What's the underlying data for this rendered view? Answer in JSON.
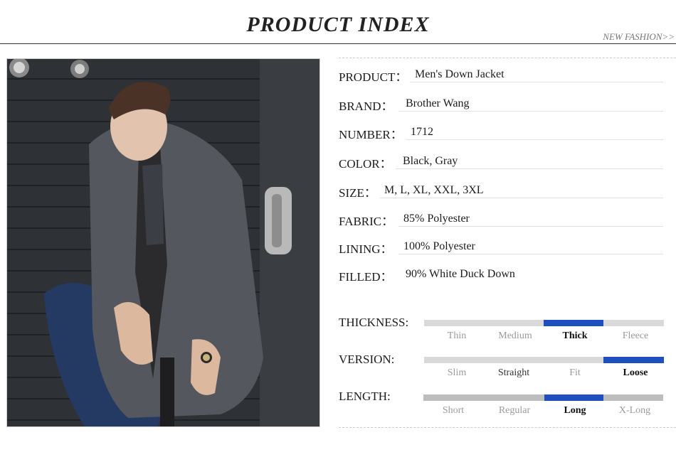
{
  "header": {
    "title": "PRODUCT INDEX",
    "tagline": "NEW FASHION>>"
  },
  "specs": [
    {
      "label": "PRODUCT：",
      "value": "Men's Down Jacket"
    },
    {
      "label": "BRAND：",
      "value": "Brother Wang"
    },
    {
      "label": "NUMBER：",
      "value": "1712"
    },
    {
      "label": "COLOR：",
      "value": "Black, Gray"
    },
    {
      "label": "SIZE：",
      "value": "M, L, XL, XXL, 3XL"
    },
    {
      "label": "FABRIC：",
      "value": "85% Polyester"
    },
    {
      "label": "LINING：",
      "value": "100% Polyester"
    },
    {
      "label": "FILLED：",
      "value": "90% White Duck Down"
    }
  ],
  "scales": [
    {
      "label": "THICKNESS:",
      "options": [
        "Thin",
        "Medium",
        "Thick",
        "Fleece"
      ],
      "selected": "Thick",
      "track_color": "#d9d9d9"
    },
    {
      "label": "VERSION:",
      "options": [
        "Slim",
        "Straight",
        "Fit",
        "Loose"
      ],
      "selected": "Loose",
      "track_color": "#d9d9d9"
    },
    {
      "label": "LENGTH:",
      "options": [
        "Short",
        "Regular",
        "Long",
        "X-Long"
      ],
      "selected": "Long",
      "track_color": "#bdbdbd"
    }
  ],
  "colors": {
    "accent": "#1f4fbf",
    "straight_text": "#333333"
  }
}
